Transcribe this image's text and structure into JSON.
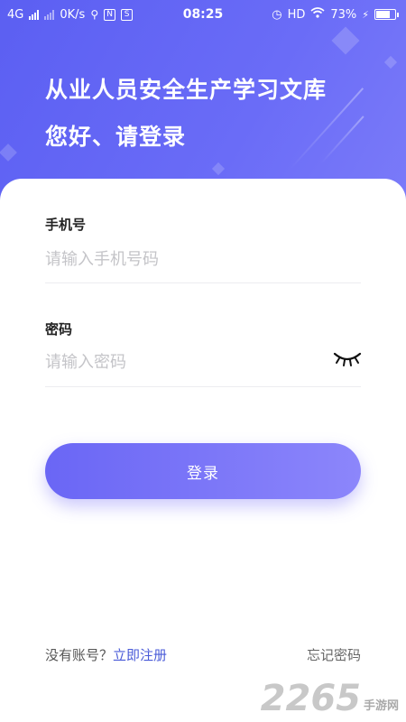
{
  "statusbar": {
    "network": "4G",
    "speed": "0K/s",
    "time": "08:25",
    "hd": "HD",
    "battery_text": "73%",
    "battery_level": 0.73,
    "s_badge": "S",
    "n_badge": "N"
  },
  "header": {
    "title": "从业人员安全生产学习文库",
    "subtitle": "您好、请登录",
    "gradient_color": "#5b5ff2"
  },
  "form": {
    "phone_label": "手机号",
    "phone_placeholder": "请输入手机号码",
    "phone_value": "",
    "password_label": "密码",
    "password_placeholder": "请输入密码",
    "password_value": "",
    "login_button": "登录"
  },
  "footer": {
    "no_account_text": "没有账号？",
    "register_link": "立即注册",
    "forgot_link": "忘记密码",
    "link_color": "#4a5bd8"
  },
  "watermark": {
    "number": "2265",
    "text": "手游网"
  }
}
